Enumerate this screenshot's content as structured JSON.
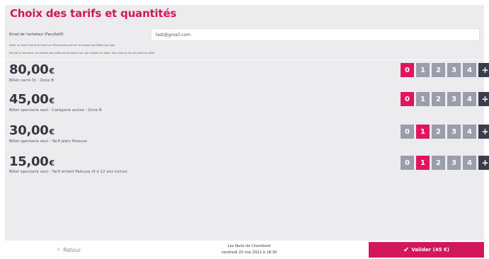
{
  "page": {
    "title": "Choix des tarifs et quantités"
  },
  "buyer": {
    "email_label": "Email de l'acheteur (Facultatif)",
    "email_value": "test@gmail.com",
    "hint_1": "Saisir un email inscrit le client sur Plusminute.com et lui envoie ses billets par mail",
    "hint_2": "Permet à l'acheteur de stocker ses billets et sa facture sur son compte en ligne, très utile en cas de perte de billet"
  },
  "tariffs": [
    {
      "price": "80,00",
      "currency": "€",
      "description": "Billet carré Or - Zone B",
      "quantity_options": [
        "0",
        "1",
        "2",
        "3",
        "4"
      ],
      "selected_quantity": "0",
      "plus_label": "+"
    },
    {
      "price": "45,00",
      "currency": "€",
      "description": "Billet spectacle seul - Catégorie assise - Zone B",
      "quantity_options": [
        "0",
        "1",
        "2",
        "3",
        "4"
      ],
      "selected_quantity": "0",
      "plus_label": "+"
    },
    {
      "price": "30,00",
      "currency": "€",
      "description": "Billet spectacle seul - Tarif plein Pelouse",
      "quantity_options": [
        "0",
        "1",
        "2",
        "3",
        "4"
      ],
      "selected_quantity": "1",
      "plus_label": "+"
    },
    {
      "price": "15,00",
      "currency": "€",
      "description": "Billet spectacle seul - Tarif enfant Pelouse (4 à 12 ans inclus)",
      "quantity_options": [
        "0",
        "1",
        "2",
        "3",
        "4"
      ],
      "selected_quantity": "1",
      "plus_label": "+"
    }
  ],
  "footer": {
    "back_label": "Retour",
    "back_icon": "chevron-left-icon",
    "event_name": "Les Nuits de Chambord",
    "event_date": "vendredi 20 mai 2022 à 18:30",
    "validate_icon": "check-icon",
    "validate_label": "Valider (45 €)"
  },
  "colors": {
    "accent": "#d2185b",
    "selected_qty": "#e3145f",
    "qty_default": "#9a9eaa",
    "plus_button": "#3a3d4a",
    "panel_bg": "#ececee"
  }
}
